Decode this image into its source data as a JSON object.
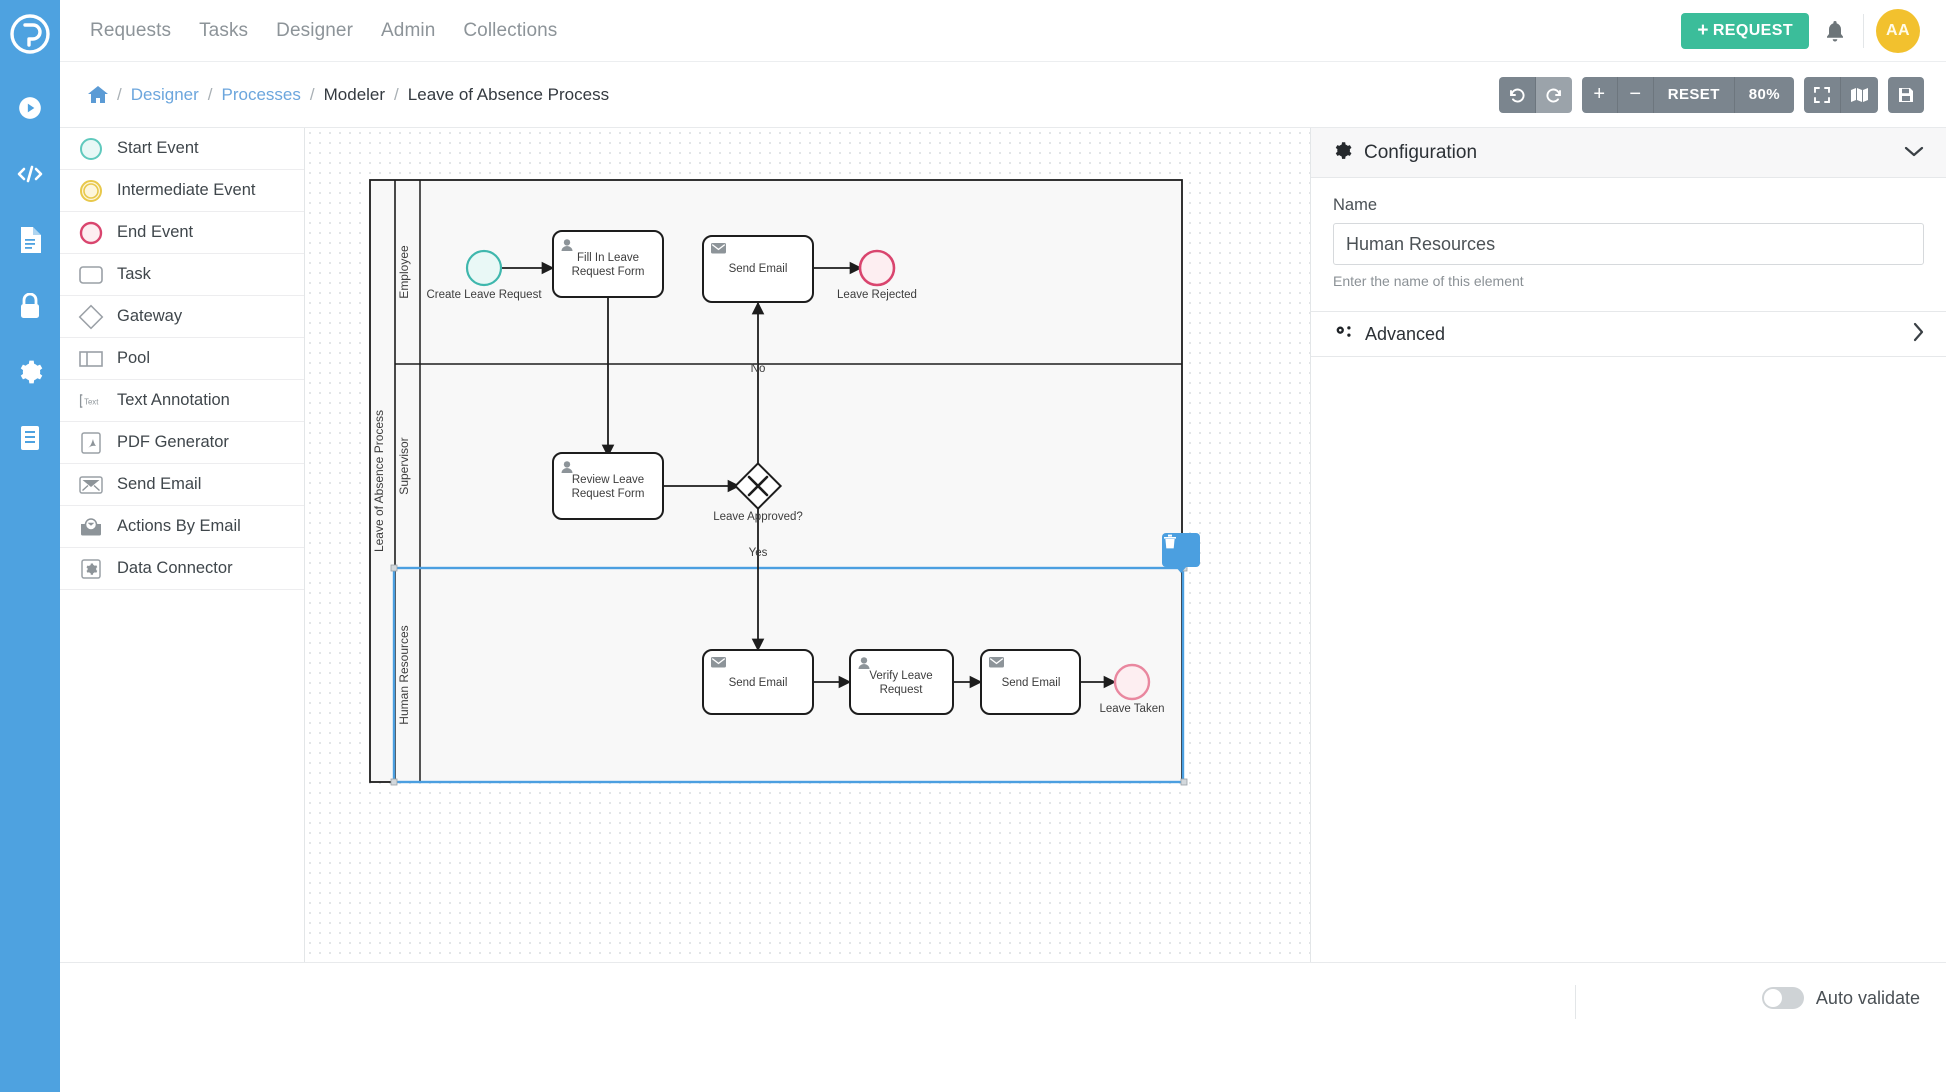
{
  "brand": {
    "logo_icon": "processmaker-logo-icon",
    "accent_blue": "#4ea2e0",
    "accent_green": "#3bbd9a",
    "avatar_yellow": "#f2c12e"
  },
  "rail": {
    "items": [
      {
        "icon": "play-circle-icon",
        "name": "requests"
      },
      {
        "icon": "code-icon",
        "name": "scripts"
      },
      {
        "icon": "document-icon",
        "name": "screens"
      },
      {
        "icon": "lock-icon",
        "name": "permissions"
      },
      {
        "icon": "gear-icon",
        "name": "settings"
      },
      {
        "icon": "list-document-icon",
        "name": "collections"
      }
    ]
  },
  "topnav": {
    "links": [
      "Requests",
      "Tasks",
      "Designer",
      "Admin",
      "Collections"
    ],
    "request_button": "REQUEST",
    "request_button_prefix": "+",
    "bell_icon": "bell-icon",
    "avatar_initials": "AA"
  },
  "breadcrumb": {
    "home_icon": "home-icon",
    "separator": "/",
    "items": [
      {
        "label": "Designer",
        "link": true
      },
      {
        "label": "Processes",
        "link": true
      },
      {
        "label": "Modeler",
        "link": false
      },
      {
        "label": "Leave of Absence Process",
        "link": false
      }
    ]
  },
  "toolbar": {
    "undo_icon": "undo-icon",
    "redo_icon": "redo-icon",
    "zoom_in": "+",
    "zoom_out": "−",
    "reset_label": "RESET",
    "zoom_level": "80%",
    "fit_icon": "fit-screen-icon",
    "map_icon": "mini-map-icon",
    "save_icon": "save-icon"
  },
  "palette": {
    "items": [
      {
        "label": "Start Event",
        "icon": "start-event-icon"
      },
      {
        "label": "Intermediate Event",
        "icon": "intermediate-event-icon"
      },
      {
        "label": "End Event",
        "icon": "end-event-icon"
      },
      {
        "label": "Task",
        "icon": "task-icon"
      },
      {
        "label": "Gateway",
        "icon": "gateway-icon"
      },
      {
        "label": "Pool",
        "icon": "pool-icon"
      },
      {
        "label": "Text Annotation",
        "icon": "text-annotation-icon"
      },
      {
        "label": "PDF Generator",
        "icon": "pdf-generator-icon"
      },
      {
        "label": "Send Email",
        "icon": "send-email-icon"
      },
      {
        "label": "Actions By Email",
        "icon": "actions-by-email-icon"
      },
      {
        "label": "Data Connector",
        "icon": "data-connector-icon"
      }
    ]
  },
  "diagram": {
    "pool_label": "Leave of Absence Process",
    "lanes": [
      {
        "label": "Employee"
      },
      {
        "label": "Supervisor"
      },
      {
        "label": "Human Resources",
        "selected": true
      }
    ],
    "nodes": [
      {
        "id": "start",
        "type": "start-event",
        "label": "Create Leave Request",
        "lane": "Employee"
      },
      {
        "id": "fill",
        "type": "user-task",
        "label": "Fill In Leave\nRequest Form",
        "line1": "Fill In Leave",
        "line2": "Request Form",
        "lane": "Employee"
      },
      {
        "id": "email_reject",
        "type": "send-email-task",
        "label": "Send Email",
        "lane": "Employee"
      },
      {
        "id": "end_rejected",
        "type": "end-event",
        "label": "Leave Rejected",
        "lane": "Employee"
      },
      {
        "id": "review",
        "type": "user-task",
        "label": "Review Leave\nRequest Form",
        "line1": "Review Leave",
        "line2": "Request Form",
        "lane": "Supervisor"
      },
      {
        "id": "gateway",
        "type": "exclusive-gateway",
        "label": "Leave Approved?",
        "lane": "Supervisor"
      },
      {
        "id": "email_hr1",
        "type": "send-email-task",
        "label": "Send Email",
        "lane": "Human Resources"
      },
      {
        "id": "verify",
        "type": "user-task",
        "label": "Verify Leave\nRequest",
        "line1": "Verify Leave",
        "line2": "Request",
        "lane": "Human Resources"
      },
      {
        "id": "email_hr2",
        "type": "send-email-task",
        "label": "Send Email",
        "lane": "Human Resources"
      },
      {
        "id": "end_taken",
        "type": "end-event",
        "label": "Leave Taken",
        "lane": "Human Resources"
      }
    ],
    "flow_labels": {
      "no": "No",
      "yes": "Yes"
    },
    "selection": {
      "target": "Human Resources",
      "delete_icon": "trash-icon",
      "handle_color": "#4b9fe0"
    }
  },
  "config": {
    "header": "Configuration",
    "header_icon": "gear-icon",
    "collapse_icon": "chevron-down-icon",
    "name_label": "Name",
    "name_value": "Human Resources",
    "name_help": "Enter the name of this element",
    "advanced_label": "Advanced",
    "advanced_icon": "gears-icon",
    "advanced_chevron": "chevron-right-icon"
  },
  "footer": {
    "auto_validate_label": "Auto validate",
    "auto_validate_on": false
  }
}
